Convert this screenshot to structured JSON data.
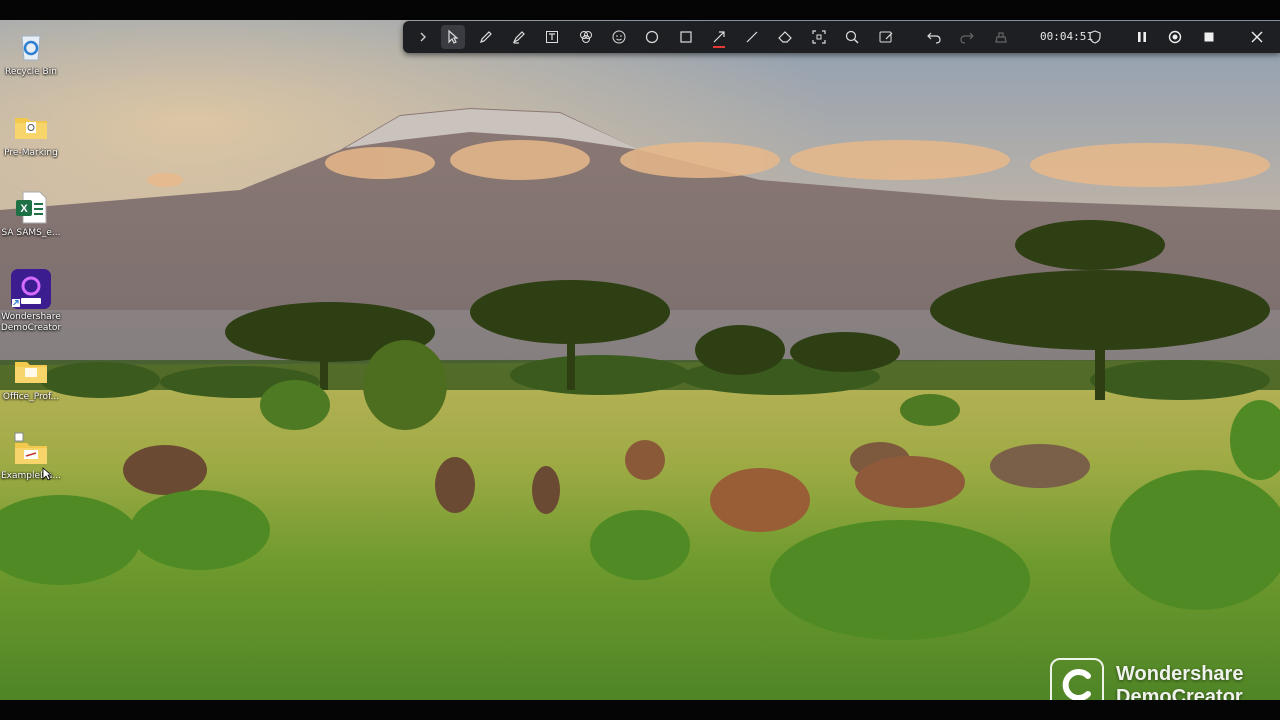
{
  "desktop_icons": [
    {
      "label": "Recycle Bin",
      "icon": "recycle-bin-icon"
    },
    {
      "label": "Pre-Marking",
      "icon": "folder-icon"
    },
    {
      "label": "SA SAMS_e...",
      "icon": "excel-file-icon"
    },
    {
      "label": "Wondershare\nDemoCreator",
      "icon": "democreator-app-icon"
    },
    {
      "label": "Office_Prof...",
      "icon": "folder-icon"
    },
    {
      "label": "ExampleDa...",
      "icon": "folder-icon"
    }
  ],
  "toolbar": {
    "tools": [
      {
        "name": "collapse",
        "icon": "chevron-right-icon"
      },
      {
        "name": "select",
        "icon": "cursor-icon",
        "active": true
      },
      {
        "name": "pen",
        "icon": "pen-icon"
      },
      {
        "name": "highlighter",
        "icon": "highlighter-icon"
      },
      {
        "name": "text",
        "icon": "text-icon"
      },
      {
        "name": "effects",
        "icon": "palette-icon"
      },
      {
        "name": "emoji",
        "icon": "emoji-icon"
      },
      {
        "name": "ellipse",
        "icon": "circle-icon"
      },
      {
        "name": "rectangle",
        "icon": "rectangle-icon"
      },
      {
        "name": "arrow",
        "icon": "arrow-icon"
      },
      {
        "name": "line",
        "icon": "line-icon"
      },
      {
        "name": "eraser",
        "icon": "eraser-icon"
      },
      {
        "name": "spotlight",
        "icon": "focus-icon"
      },
      {
        "name": "magnifier",
        "icon": "magnifier-icon"
      },
      {
        "name": "whiteboard",
        "icon": "whiteboard-icon"
      },
      {
        "name": "undo",
        "icon": "undo-icon"
      },
      {
        "name": "redo",
        "icon": "redo-icon"
      },
      {
        "name": "clear",
        "icon": "clear-icon"
      }
    ],
    "timer": "00:04:51",
    "pen_color": "#e53935",
    "controls": [
      {
        "name": "shield",
        "icon": "shield-icon"
      },
      {
        "name": "pause",
        "icon": "pause-icon"
      },
      {
        "name": "webcam",
        "icon": "record-icon"
      },
      {
        "name": "stop",
        "icon": "stop-icon"
      },
      {
        "name": "close",
        "icon": "close-icon"
      }
    ]
  },
  "watermark": {
    "line1": "Wondershare",
    "line2": "DemoCreator"
  }
}
